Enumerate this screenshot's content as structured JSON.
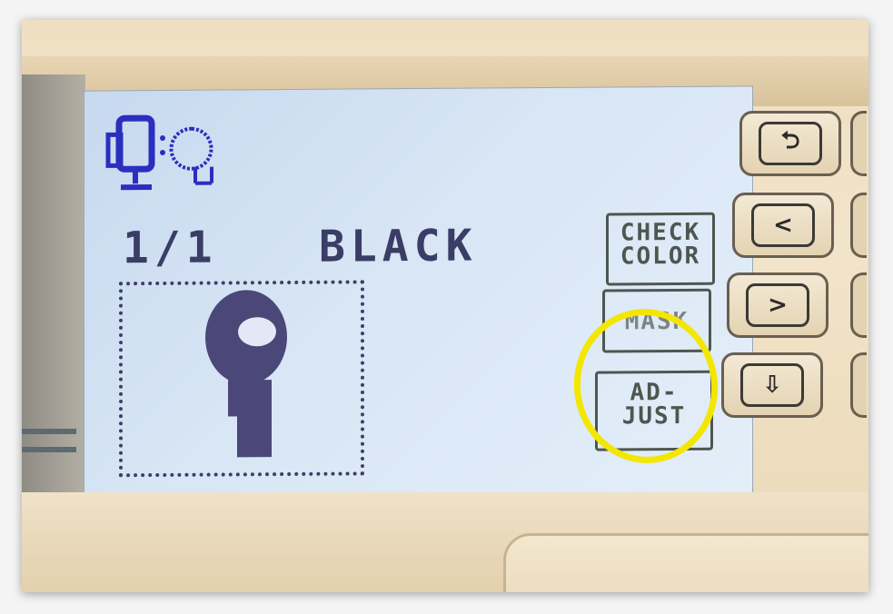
{
  "display": {
    "line_status": "1/1",
    "color_name": "BLACK",
    "buttons": {
      "check_color": "CHECK COLOR",
      "mask": "MASK",
      "adjust": "AD- JUST"
    }
  },
  "keypad": {
    "keys": [
      {
        "icon": "back-arrow-icon",
        "glyph": "⮌"
      },
      {
        "icon": "left-chevron-icon",
        "glyph": "<"
      },
      {
        "icon": "right-chevron-icon",
        "glyph": ">"
      },
      {
        "icon": "load-tray-icon",
        "glyph": "⇩"
      }
    ]
  },
  "colors": {
    "lcd_ink": "#3a3d66",
    "button_ink": "#4d5650",
    "highlight": "#f3e600",
    "lcd_bg": "#d8e6f5"
  }
}
